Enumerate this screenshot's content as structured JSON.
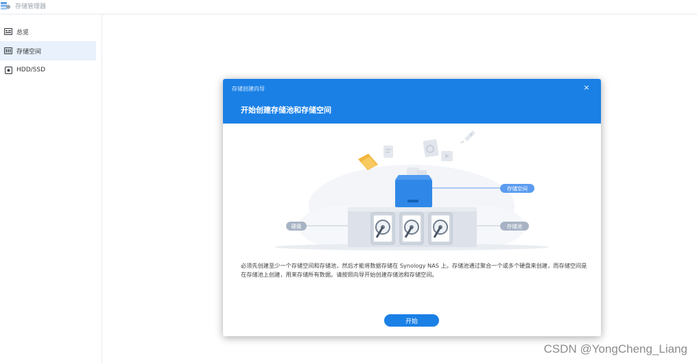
{
  "app": {
    "title": "存储管理器"
  },
  "sidebar": {
    "items": [
      {
        "label": "总览",
        "icon": "overview-icon"
      },
      {
        "label": "存储空间",
        "icon": "storage-volume-icon",
        "active": true
      },
      {
        "label": "HDD/SSD",
        "icon": "disk-icon"
      }
    ]
  },
  "dialog": {
    "wizard_label": "存储创建向导",
    "close_glyph": "×",
    "title": "开始创建存储池和存储空间",
    "illustration": {
      "label_volume": "存储空间",
      "label_disk": "硬盘",
      "label_pool": "存储池"
    },
    "description": "必须先创建至少一个存储空间和存储池，然后才能将数据存储在 Synology NAS 上。存储池通过聚合一个或多个硬盘来创建，而存储空间是在存储池上创建，用来存储所有数据。请按照向导开始创建存储池和存储空间。",
    "start_button": "开始"
  },
  "watermark": "CSDN @YongCheng_Liang",
  "colors": {
    "accent": "#1a80e6",
    "active_bg": "#e8f1fc",
    "label_pill": "#5b9cf0",
    "disk_pill": "#a7b3c4"
  }
}
